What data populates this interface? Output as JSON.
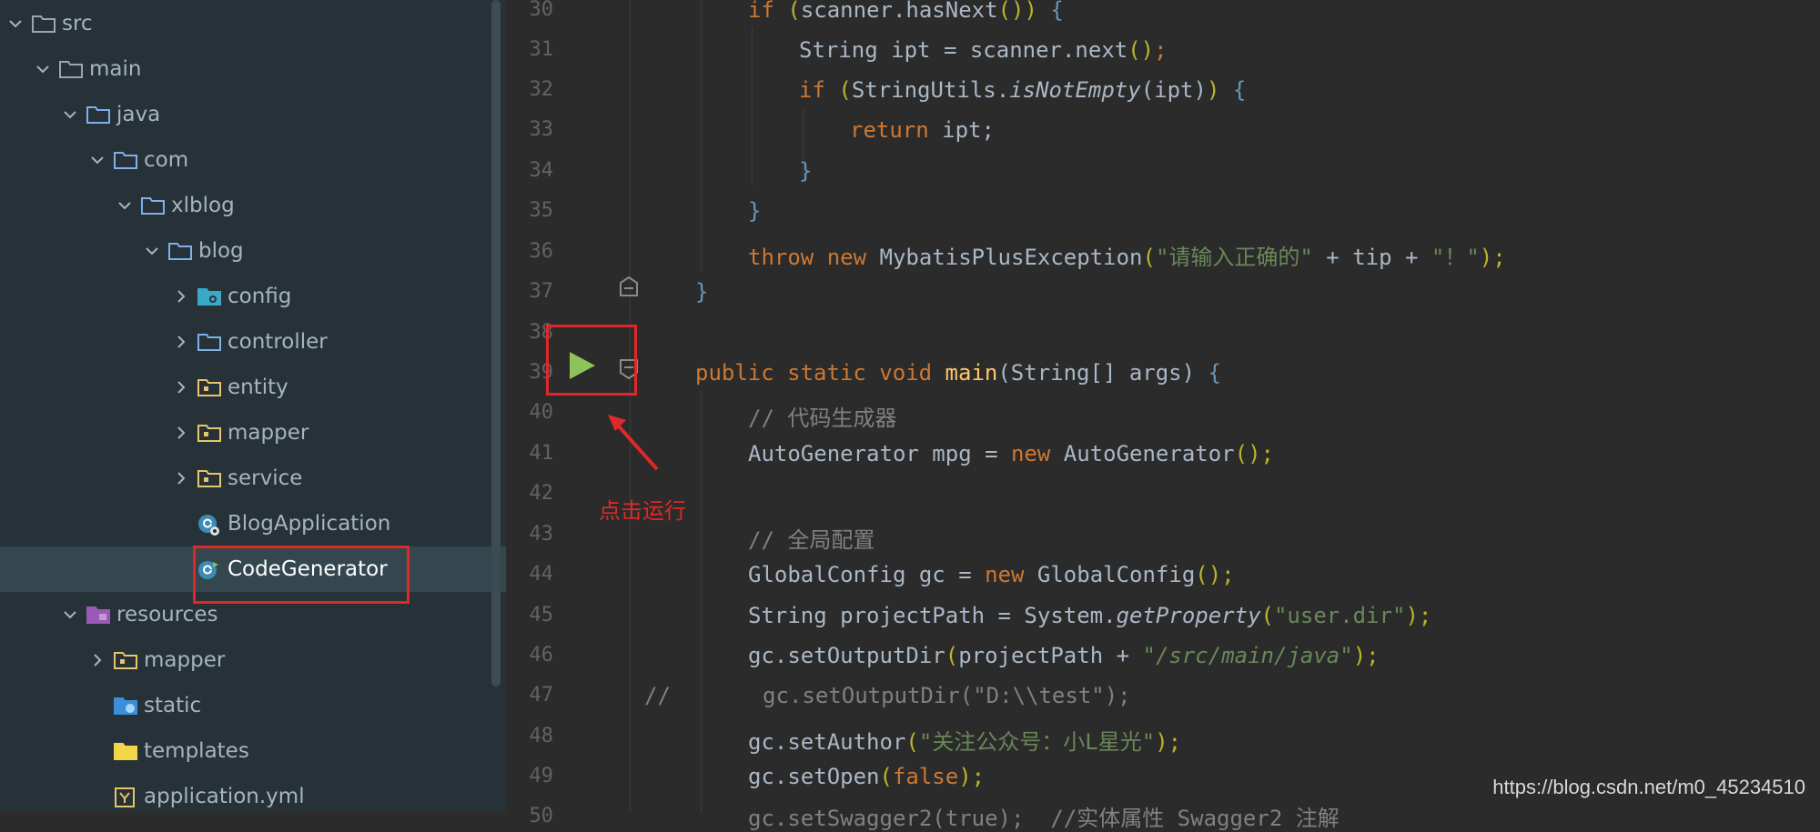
{
  "project_tree": {
    "items": [
      {
        "label": "src",
        "icon": "folder-icon",
        "expanded": true
      },
      {
        "label": "main",
        "icon": "folder-icon",
        "expanded": true
      },
      {
        "label": "java",
        "icon": "source-folder-icon",
        "expanded": true
      },
      {
        "label": "com",
        "icon": "package-icon",
        "expanded": true
      },
      {
        "label": "xlblog",
        "icon": "package-icon",
        "expanded": true
      },
      {
        "label": "blog",
        "icon": "package-icon",
        "expanded": true
      },
      {
        "label": "config",
        "icon": "config-folder-icon",
        "expanded": false
      },
      {
        "label": "controller",
        "icon": "package-icon",
        "expanded": false
      },
      {
        "label": "entity",
        "icon": "package-icon",
        "expanded": false
      },
      {
        "label": "mapper",
        "icon": "package-icon",
        "expanded": false
      },
      {
        "label": "service",
        "icon": "package-icon",
        "expanded": false
      },
      {
        "label": "BlogApplication",
        "icon": "spring-boot-class-icon"
      },
      {
        "label": "CodeGenerator",
        "icon": "class-icon"
      },
      {
        "label": "resources",
        "icon": "resources-folder-icon",
        "expanded": true
      },
      {
        "label": "mapper",
        "icon": "package-icon",
        "expanded": false
      },
      {
        "label": "static",
        "icon": "web-folder-icon"
      },
      {
        "label": "templates",
        "icon": "folder-icon"
      },
      {
        "label": "application.yml",
        "icon": "yaml-file-icon"
      }
    ]
  },
  "editor": {
    "line_numbers": [
      "30",
      "31",
      "32",
      "33",
      "34",
      "35",
      "36",
      "37",
      "38",
      "39",
      "40",
      "41",
      "42",
      "43",
      "44",
      "45",
      "46",
      "47",
      "48",
      "49",
      "50"
    ],
    "lines": {
      "l30": {
        "a": "if ",
        "b": "(",
        "c": "scanner.hasNext",
        "d": "())",
        "e": " {"
      },
      "l31": {
        "a": "String ipt = scanner.next",
        "b": "()",
        "c": ";"
      },
      "l32": {
        "a": "if ",
        "b": "(",
        "c": "StringUtils.",
        "d": "isNotEmpty",
        "e": "(ipt)",
        "f": ")",
        "g": " {"
      },
      "l33": {
        "a": "return ",
        "b": "ipt;"
      },
      "l34": {
        "a": "}"
      },
      "l35": {
        "a": "}"
      },
      "l36": {
        "a": "throw new ",
        "b": "MybatisPlusException",
        "c": "(",
        "d": "\"请输入正确的\"",
        "e": " + tip + ",
        "f": "\"！\"",
        "g": ");"
      },
      "l37": {
        "a": "}"
      },
      "l39": {
        "a": "public static void ",
        "b": "main",
        "c": "(String[] args)",
        "d": " {"
      },
      "l40": {
        "a": "// 代码生成器"
      },
      "l41": {
        "a": "AutoGenerator mpg = ",
        "b": "new ",
        "c": "AutoGenerator",
        "d": "();"
      },
      "l43": {
        "a": "// 全局配置"
      },
      "l44": {
        "a": "GlobalConfig gc = ",
        "b": "new ",
        "c": "GlobalConfig",
        "d": "();"
      },
      "l45": {
        "a": "String projectPath = System.",
        "b": "getProperty",
        "c": "(",
        "d": "\"user.dir\"",
        "e": ");"
      },
      "l46": {
        "a": "gc.setOutputDir",
        "b": "(",
        "c": "projectPath + ",
        "d": "\"/src/main/java\"",
        "e": ");"
      },
      "l47": {
        "a": "//       gc.setOutputDir(\"D:\\\\test\");"
      },
      "l48": {
        "a": "gc.setAuthor",
        "b": "(",
        "c": "\"关注公众号：小L星光\"",
        "d": ");"
      },
      "l49": {
        "a": "gc.setOpen",
        "b": "(",
        "c": "false",
        "d": ");"
      },
      "l50": {
        "a": "gc.setSwagger2(true);  //实体属性 Swagger2 注解"
      }
    }
  },
  "annotation": {
    "text": "点击运行"
  },
  "watermark": {
    "text": "https://blog.csdn.net/m0_45234510"
  },
  "colors": {
    "annotation_red": "#e02828",
    "run_green": "#8ec25a",
    "tree_bg": "#263238",
    "editor_bg": "#2b2b2b"
  }
}
